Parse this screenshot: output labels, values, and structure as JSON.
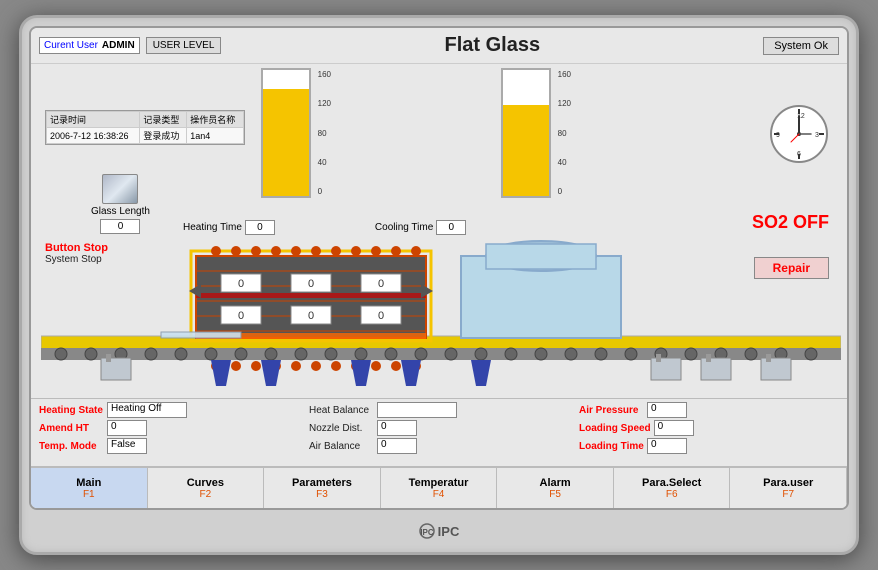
{
  "monitor": {
    "title": "Flat Glass",
    "system_status": "System Ok",
    "logo": "IPC",
    "so2_status": "SO2 OFF"
  },
  "header": {
    "current_user_label": "Curent User",
    "current_user_value": "ADMIN",
    "user_level_label": "USER LEVEL"
  },
  "log": {
    "headers": [
      "记录时间",
      "记录类型",
      "操作员名称"
    ],
    "row1": [
      "2006-7-12  16:38:26",
      "登录成功",
      "1an4"
    ]
  },
  "gauges": {
    "left_labels": [
      "160",
      "120",
      "80",
      "40"
    ],
    "right_labels": [
      "160",
      "120",
      "80",
      "40"
    ],
    "left_fill_percent": 85,
    "right_fill_percent": 72
  },
  "glass": {
    "length_label": "Glass Length",
    "length_value": "0"
  },
  "times": {
    "heating_label": "Heating Time",
    "heating_value": "0",
    "cooling_label": "Cooling Time",
    "cooling_value": "0"
  },
  "controls": {
    "button_stop_label": "Button Stop",
    "system_stop_label": "System Stop",
    "repair_label": "Repair"
  },
  "bottom_panel": {
    "heating_state_label": "Heating State",
    "heating_state_value": "Heating Off",
    "amend_ht_label": "Amend  HT",
    "amend_ht_value": "0",
    "temp_mode_label": "Temp.  Mode",
    "temp_mode_value": "False",
    "heat_balance_label": "Heat Balance",
    "heat_balance_value": "",
    "nozzle_dist_label": "Nozzle Dist.",
    "nozzle_dist_value": "0",
    "air_balance_label": "Air Balance",
    "air_balance_value": "0",
    "air_pressure_label": "Air Pressure",
    "air_pressure_value": "0",
    "loading_speed_label": "Loading Speed",
    "loading_speed_value": "0",
    "loading_time_label": "Loading Time",
    "loading_time_value": "0"
  },
  "navbar": {
    "items": [
      {
        "label": "Main",
        "key": "F1",
        "active": true
      },
      {
        "label": "Curves",
        "key": "F2",
        "active": false
      },
      {
        "label": "Parameters",
        "key": "F3",
        "active": false
      },
      {
        "label": "Temperatur",
        "key": "F4",
        "active": false
      },
      {
        "label": "Alarm",
        "key": "F5",
        "active": false
      },
      {
        "label": "Para.Select",
        "key": "F6",
        "active": false
      },
      {
        "label": "Para.user",
        "key": "F7",
        "active": false
      }
    ]
  }
}
